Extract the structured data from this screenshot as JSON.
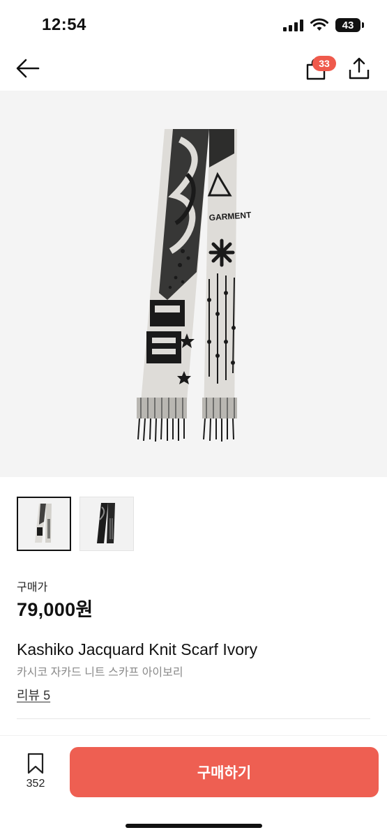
{
  "status_bar": {
    "time": "12:54",
    "battery": "43"
  },
  "header": {
    "cart_count": "33",
    "icons": [
      "back-arrow-icon",
      "shopping-bag-icon",
      "share-icon"
    ]
  },
  "product": {
    "main_image": "knit-scarf-ivory-photo",
    "thumbnails": [
      "ivory-scarf",
      "black-scarf"
    ],
    "scarf_text": "GARMENT",
    "price_label": "구매가",
    "price": "79,000원",
    "name": "Kashiko Jacquard Knit Scarf Ivory",
    "name_korean": "카시코 자카드 니트 스카프 아이보리",
    "review_link": "리뷰 5"
  },
  "bottom_bar": {
    "wishlist_count": "352",
    "buy_label": "구매하기"
  },
  "colors": {
    "accent": "#ee5f52",
    "badge": "#ef5a4c",
    "hero_bg": "#f4f4f4",
    "scarf_ivory": "#dedcd8"
  }
}
